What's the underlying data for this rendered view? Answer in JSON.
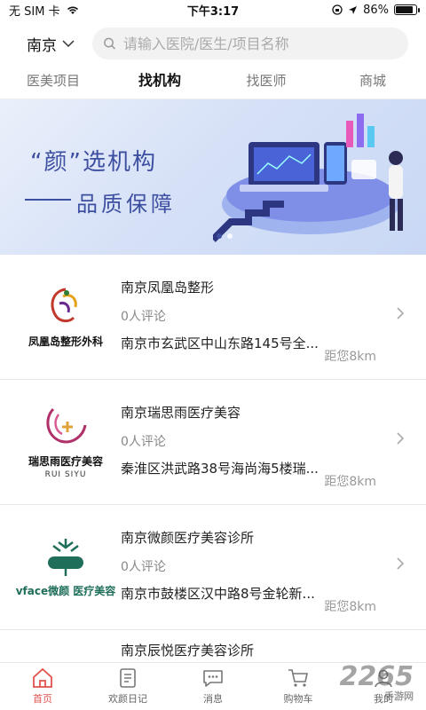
{
  "status_bar": {
    "carrier": "无 SIM 卡",
    "time": "下午3:17",
    "battery": "86%",
    "battery_level": 0.86
  },
  "header": {
    "city": "南京",
    "search_placeholder": "请输入医院/医生/项目名称"
  },
  "tabs": [
    {
      "label": "医美项目",
      "active": false
    },
    {
      "label": "找机构",
      "active": true
    },
    {
      "label": "找医师",
      "active": false
    },
    {
      "label": "商城",
      "active": false
    }
  ],
  "banner": {
    "line1": "“颜”选机构",
    "line2": "品质保障"
  },
  "institutions": [
    {
      "name": "南京凤凰岛整形",
      "reviews": "0人评论",
      "address": "南京市玄武区中山东路145号全...",
      "distance": "距您8km",
      "logo_text": "凤凰岛整形外科",
      "logo_color": "#c0392b"
    },
    {
      "name": "南京瑞思雨医疗美容",
      "reviews": "0人评论",
      "address": "秦淮区洪武路38号海尚海5楼瑞...",
      "distance": "距您8km",
      "logo_text": "瑞思雨医疗美容",
      "logo_sub": "RUI SIYU",
      "logo_color": "#b0306a"
    },
    {
      "name": "南京微颜医疗美容诊所",
      "reviews": "0人评论",
      "address": "南京市鼓楼区汉中路8号金轮新...",
      "distance": "距您8km",
      "logo_text": "vface微颜 医疗美容",
      "logo_color": "#1f6e5a"
    },
    {
      "name": "南京辰悦医疗美容诊所",
      "reviews": "",
      "address": "",
      "distance": "",
      "logo_text": "",
      "logo_color": "#1f6e5a"
    }
  ],
  "bottom_nav": [
    {
      "label": "首页",
      "icon": "home-icon",
      "active": true
    },
    {
      "label": "欢颜日记",
      "icon": "diary-icon",
      "active": false
    },
    {
      "label": "消息",
      "icon": "message-icon",
      "active": false
    },
    {
      "label": "购物车",
      "icon": "cart-icon",
      "active": false
    },
    {
      "label": "我的",
      "icon": "profile-icon",
      "active": false
    }
  ],
  "watermark": {
    "main": "2265",
    "sub": "手游网"
  },
  "colors": {
    "accent": "#e0534f",
    "banner_text": "#3d4fa0"
  }
}
